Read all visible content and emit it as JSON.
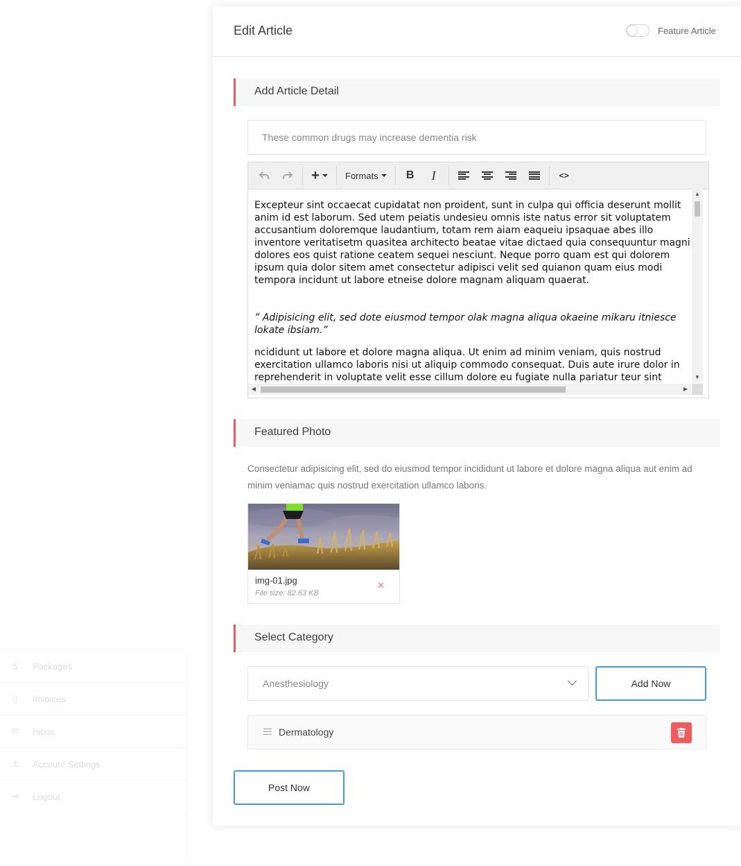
{
  "card": {
    "title": "Edit Article",
    "feature_toggle_label": "Feature Article",
    "feature_toggle_on": false
  },
  "sections": {
    "article_detail": "Add Article Detail",
    "featured_photo": "Featured Photo",
    "select_category": "Select Category"
  },
  "article": {
    "title_value": "These common drugs may increase dementia risk"
  },
  "editor": {
    "toolbar": {
      "formats_label": "Formats"
    },
    "paragraphs": [
      "Excepteur sint occaecat cupidatat non proident, sunt in culpa qui officia deserunt mollit anim id est laborum. Sed utem peiatis undesieu omnis iste natus error sit voluptatem accusantium doloremque laudantium, totam rem aiam eaqueiu ipsaquae abes illo inventore veritatisetm quasitea architecto beatae vitae dictaed quia consequuntur magni dolores eos quist ratione ceatem sequei nesciunt. Neque porro quam est qui dolorem ipsum quia dolor sitem amet consectetur adipisci velit sed quianon quam eius modi tempora incidunt ut labore etneise dolore magnam aliquam quaerat.",
      "” Adipisicing elit, sed dote eiusmod tempor olak magna aliqua okaeine mikaru itniesce lokate ibsiam.”",
      "ncididunt ut labore et dolore magna aliqua. Ut enim ad minim veniam, quis nostrud exercitation ullamco laboris nisi ut aliquip commodo consequat. Duis aute irure dolor in reprehenderit in voluptate velit esse cillum dolore eu fugiate nulla pariatur teur sint occaecat cupidatat nipon proident sunt in culpa qui"
    ]
  },
  "photo": {
    "description": "Consectetur adipisicing elit, sed do eiusmod tempor incididunt ut labore et dolore magna aliqua aut enim ad minim veniamac quis nostrud exercitation ullamco laboris.",
    "file_name": "img-01.jpg",
    "file_size": "File size: 82.63 KB"
  },
  "category": {
    "selected": "Anesthesiology",
    "add_button": "Add Now",
    "items": [
      "Dermatology"
    ]
  },
  "post_button": "Post Now",
  "sidebar": {
    "items": [
      {
        "label": "Packages",
        "icon": "dollar-icon"
      },
      {
        "label": "Invoices",
        "icon": "file-icon"
      },
      {
        "label": "Inbox",
        "icon": "envelope-icon"
      },
      {
        "label": "Account Settings",
        "icon": "anchor-icon"
      },
      {
        "label": "Logout",
        "icon": "logout-icon"
      }
    ]
  },
  "colors": {
    "accent_red": "#f15b5b",
    "accent_blue": "#3d9be9"
  }
}
